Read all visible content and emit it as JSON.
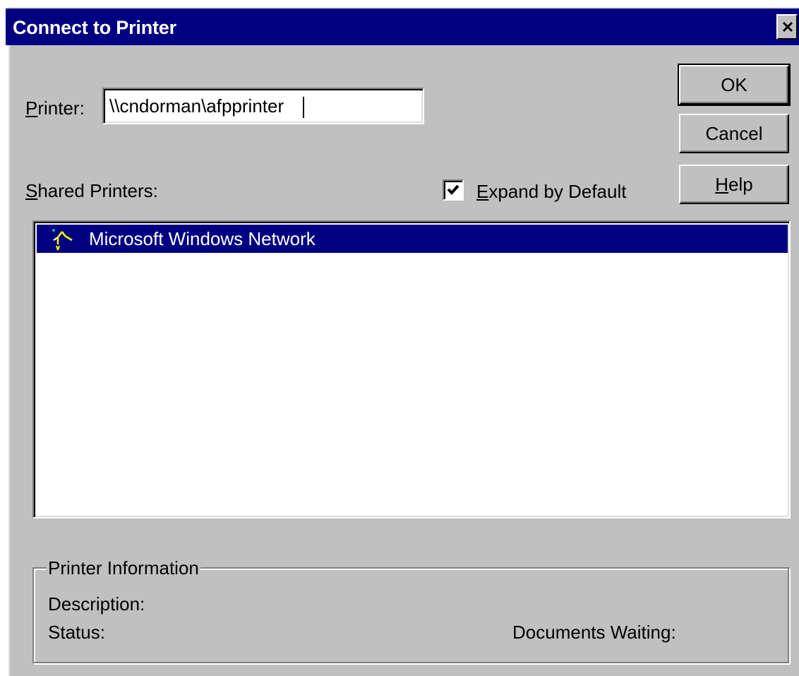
{
  "window": {
    "title": "Connect to Printer",
    "close_icon": "close-icon"
  },
  "printer_field": {
    "label": "Printer:",
    "accelerator": "P",
    "label_rest": "rinter:",
    "value": "\\\\cndorman\\afpprinter"
  },
  "buttons": {
    "ok": "OK",
    "cancel": "Cancel",
    "help": "Help",
    "help_accelerator": "H",
    "help_rest": "elp"
  },
  "shared_printers": {
    "label": "Shared Printers:",
    "accelerator": "S",
    "label_rest": "hared Printers:",
    "expand_by_default": {
      "label": "Expand by Default",
      "accelerator": "E",
      "label_rest": "xpand by Default",
      "checked": true
    },
    "items": [
      {
        "label": "Microsoft Windows Network",
        "icon": "network-icon",
        "selected": true
      }
    ]
  },
  "printer_information": {
    "legend": "Printer Information",
    "description_label": "Description:",
    "status_label": "Status:",
    "documents_waiting_label": "Documents Waiting:"
  },
  "colors": {
    "face": "#c0c0c0",
    "titlebar": "#000080",
    "selection": "#000080",
    "window": "#ffffff"
  }
}
